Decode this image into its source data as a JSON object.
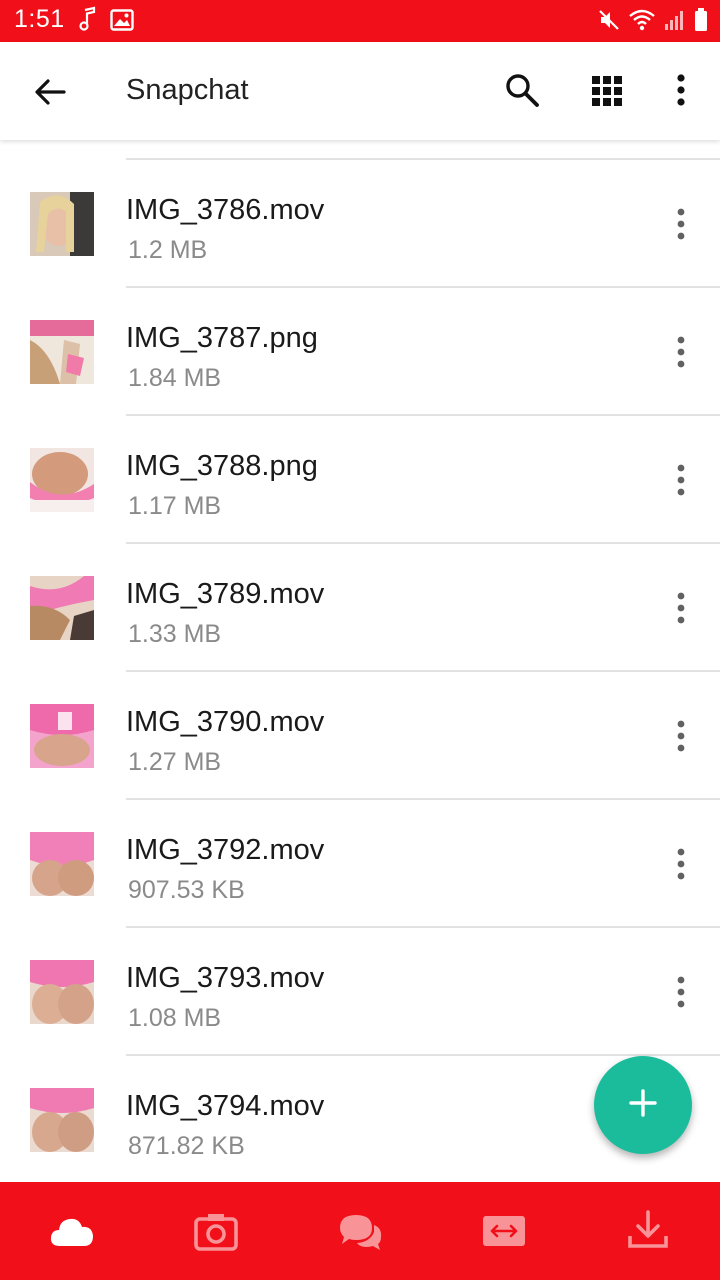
{
  "status_bar": {
    "time": "1:51",
    "icons": [
      "music-note-icon",
      "image-icon",
      "mute-icon",
      "wifi-icon",
      "signal-icon",
      "battery-icon"
    ]
  },
  "app_bar": {
    "title": "Snapchat",
    "icons": [
      "back-arrow-icon",
      "search-icon",
      "grid-view-icon",
      "more-vert-icon"
    ]
  },
  "files": [
    {
      "name": "IMG_3786.mov",
      "size": "1.2 MB"
    },
    {
      "name": "IMG_3787.png",
      "size": "1.84 MB"
    },
    {
      "name": "IMG_3788.png",
      "size": "1.17 MB"
    },
    {
      "name": "IMG_3789.mov",
      "size": "1.33 MB"
    },
    {
      "name": "IMG_3790.mov",
      "size": "1.27 MB"
    },
    {
      "name": "IMG_3792.mov",
      "size": "907.53 KB"
    },
    {
      "name": "IMG_3793.mov",
      "size": "1.08 MB"
    },
    {
      "name": "IMG_3794.mov",
      "size": "871.82 KB"
    }
  ],
  "fab": {
    "icon": "plus-icon"
  },
  "bottom_nav": {
    "items": [
      "cloud-icon",
      "camera-icon",
      "chat-icon",
      "transfer-icon",
      "download-icon"
    ]
  },
  "colors": {
    "primary": "#f10f19",
    "accent": "#1abc9c",
    "text_primary": "#1a1a1a",
    "text_secondary": "#8a8a8a"
  }
}
